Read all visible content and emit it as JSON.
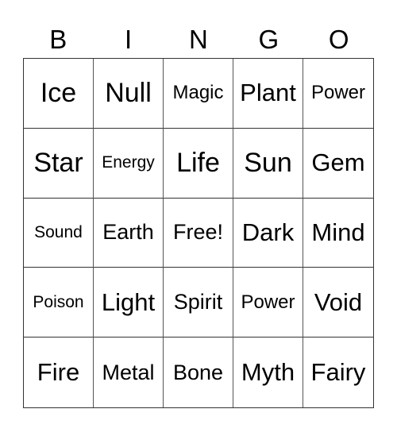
{
  "header": [
    "B",
    "I",
    "N",
    "G",
    "O"
  ],
  "cells": [
    {
      "text": "Ice",
      "size": "s36"
    },
    {
      "text": "Null",
      "size": "s36"
    },
    {
      "text": "Magic",
      "size": "s24"
    },
    {
      "text": "Plant",
      "size": "s32"
    },
    {
      "text": "Power",
      "size": "s24"
    },
    {
      "text": "Star",
      "size": "s36"
    },
    {
      "text": "Energy",
      "size": "s20"
    },
    {
      "text": "Life",
      "size": "s36"
    },
    {
      "text": "Sun",
      "size": "s36"
    },
    {
      "text": "Gem",
      "size": "s32"
    },
    {
      "text": "Sound",
      "size": "s20"
    },
    {
      "text": "Earth",
      "size": "s28"
    },
    {
      "text": "Free!",
      "size": "s28"
    },
    {
      "text": "Dark",
      "size": "s32"
    },
    {
      "text": "Mind",
      "size": "s32"
    },
    {
      "text": "Poison",
      "size": "s20"
    },
    {
      "text": "Light",
      "size": "s32"
    },
    {
      "text": "Spirit",
      "size": "s28"
    },
    {
      "text": "Power",
      "size": "s24"
    },
    {
      "text": "Void",
      "size": "s32"
    },
    {
      "text": "Fire",
      "size": "s32"
    },
    {
      "text": "Metal",
      "size": "s27"
    },
    {
      "text": "Bone",
      "size": "s28"
    },
    {
      "text": "Myth",
      "size": "s32"
    },
    {
      "text": "Fairy",
      "size": "s32"
    }
  ]
}
